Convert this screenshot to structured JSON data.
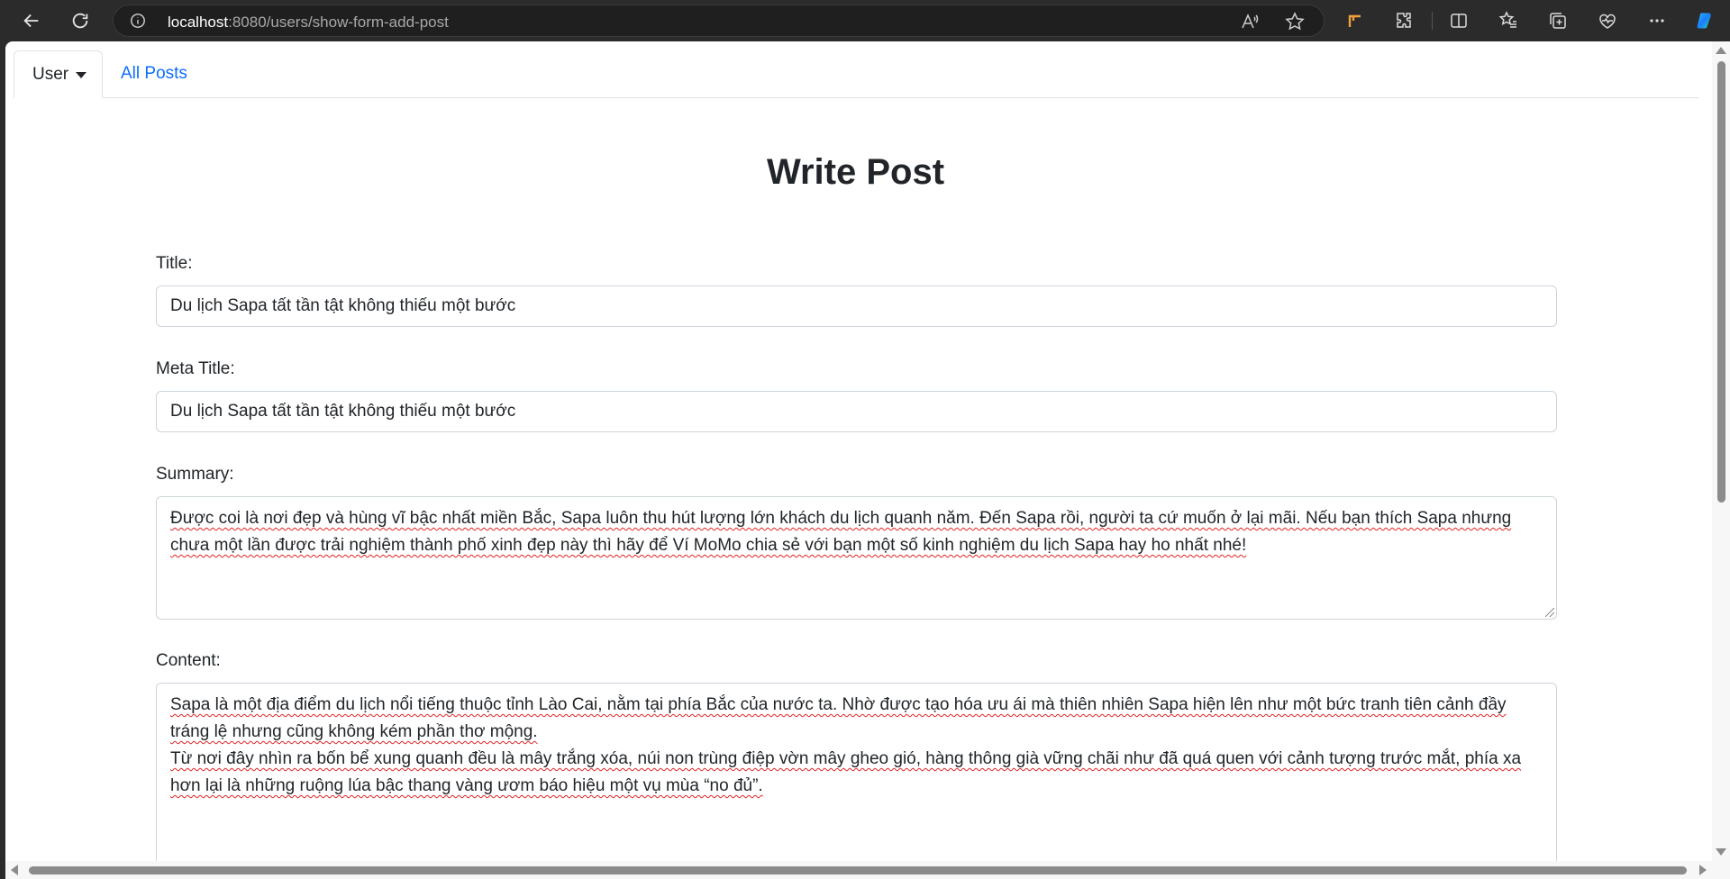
{
  "browser": {
    "url_host": "localhost",
    "url_rest": ":8080/users/show-form-add-post"
  },
  "tabs": {
    "user_label": "User",
    "all_posts_label": "All Posts"
  },
  "page_title": "Write Post",
  "form": {
    "title_label": "Title:",
    "title_value": "Du lịch Sapa tất tần tật không thiếu một bước",
    "meta_title_label": "Meta Title:",
    "meta_title_value": "Du lịch Sapa tất tần tật không thiếu một bước",
    "summary_label": "Summary:",
    "summary_value": "Được coi là nơi đẹp và hùng vĩ bậc nhất miền Bắc, Sapa luôn thu hút lượng lớn khách du lịch quanh năm. Đến Sapa rồi, người ta cứ muốn ở lại mãi. Nếu bạn thích Sapa nhưng chưa một lần được trải nghiệm thành phố xinh đẹp này thì hãy để Ví MoMo chia sẻ với bạn một số kinh nghiệm du lịch Sapa hay ho nhất nhé!",
    "content_label": "Content:",
    "content_paragraphs": [
      "Sapa là một địa điểm du lịch nổi tiếng thuộc tỉnh Lào Cai, nằm tại phía Bắc của nước ta. Nhờ được tạo hóa ưu ái mà thiên nhiên Sapa hiện lên như một bức tranh tiên cảnh đầy tráng lệ nhưng cũng không kém phần thơ mộng.",
      "Từ nơi đây nhìn ra bốn bể xung quanh đều là mây trắng xóa, núi non trùng điệp vờn mây gheo gió, hàng thông già vững chãi như đã quá quen với cảnh tượng trước mắt, phía xa hơn lại là những ruộng lúa bậc thang vàng ươm báo hiệu một vụ mùa “no đủ”."
    ]
  },
  "colors": {
    "link": "#0d6efd",
    "text": "#212529",
    "border": "#ced4da"
  }
}
